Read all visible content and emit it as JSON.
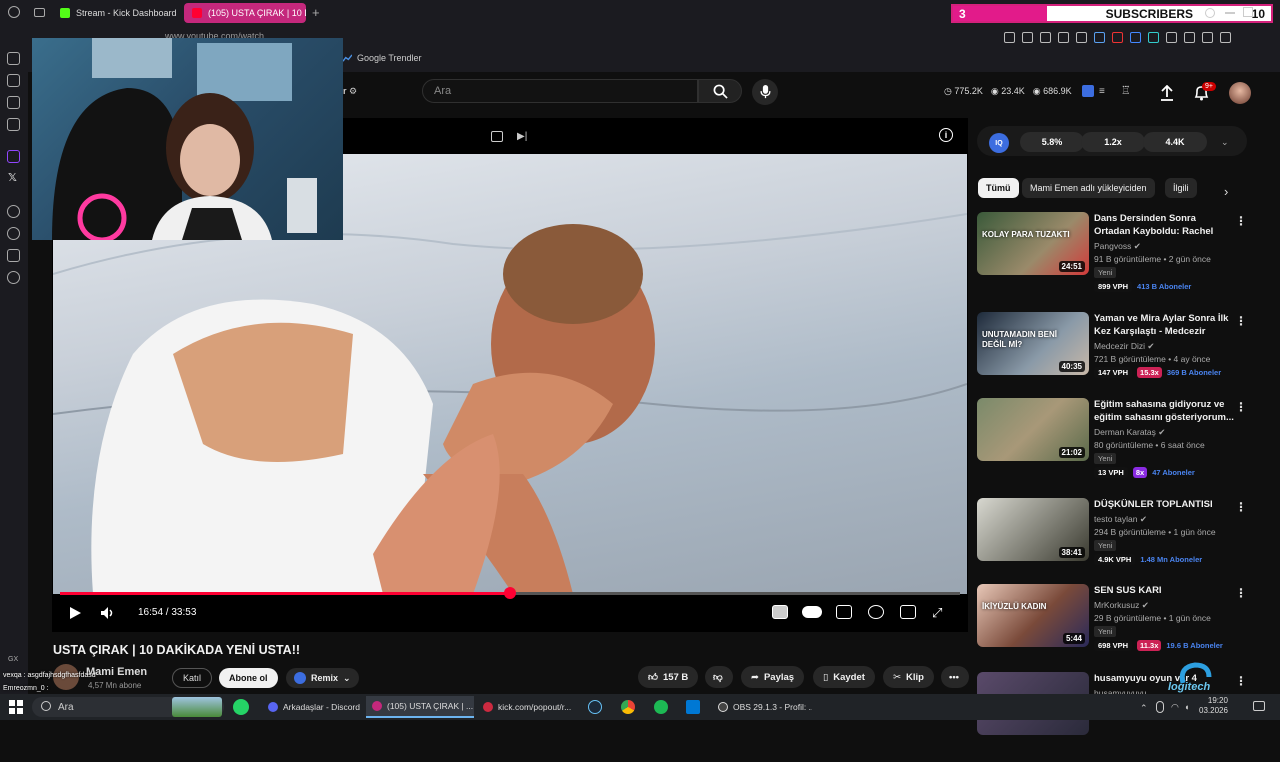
{
  "browser": {
    "tabs": [
      {
        "label": "Stream - Kick Dashboard",
        "color": "#53fc18"
      },
      {
        "label": "(105) USTA ÇIRAK | 10 DAK",
        "color": "#ff0033"
      }
    ],
    "new_tab_glyph": "+",
    "address": "www.youtube.com/watch",
    "bookmark": "Google Trendler"
  },
  "overlay": {
    "subscriber_count": "3",
    "subscriber_label": "SUBSCRIBERS",
    "subscriber_goal": "10",
    "chat_lines": [
      "vexqa : asgdfajhsdgfhasfdasd",
      "Emreozmn_0 :"
    ],
    "gx": "GX"
  },
  "youtube": {
    "search_placeholder": "Ara",
    "filter_glyph": "r",
    "stats": {
      "views": "775.2K",
      "likes": "23.4K",
      "other": "686.9K"
    },
    "notifications": "9+",
    "player": {
      "time": "16:54 / 33:53",
      "progress": 0.5
    },
    "video": {
      "title": "USTA ÇIRAK | 10 DAKİKADA YENİ USTA!!",
      "channel": "Mami Emen",
      "channel_subs": "4,57 Mn abone",
      "join": "Katıl",
      "subscribe": "Abone ol",
      "remix": "Remix",
      "likes": "157 B",
      "share": "Paylaş",
      "save": "Kaydet",
      "clip": "Klip"
    },
    "iq_bar": {
      "logo": "IQ",
      "pills": [
        "5.8%",
        "1.2x",
        "4.4K"
      ]
    },
    "chips": [
      "Tümü",
      "Mami Emen adlı yükleyiciden",
      "İlgili"
    ],
    "recommendations": [
      {
        "title": "Dans Dersinden Sonra Ortadan Kayboldu: Rachel Barber'a Ne ...",
        "channel": "Pangvoss",
        "meta": "91 B görüntüleme • 2 gün önce",
        "badge": "Yeni",
        "vph": "899 VPH",
        "mult": "",
        "subs": "413 B Aboneler",
        "duration": "24:51",
        "thumb_text": "KOLAY PARA TUZAKTI"
      },
      {
        "title": "Yaman ve Mira Aylar Sonra İlk Kez Karşılaştı - Medcezir",
        "channel": "Medcezir Dizi",
        "meta": "721 B görüntüleme • 4 ay önce",
        "badge": "",
        "vph": "147 VPH",
        "mult": "15.3x",
        "mult_color": "#cc2255",
        "subs": "369 B Aboneler",
        "duration": "40:35",
        "thumb_text": "UNUTAMADIN BENİ DEĞİL Mİ?"
      },
      {
        "title": "Eğitim sahasına gidiyoruz ve eğitim sahasını gösteriyorum...",
        "channel": "Derman Karataş",
        "meta": "80 görüntüleme • 6 saat önce",
        "badge": "Yeni",
        "vph": "13 VPH",
        "mult": "8x",
        "mult_color": "#8a2be2",
        "subs": "47 Aboneler",
        "duration": "21:02",
        "thumb_text": ""
      },
      {
        "title": "DÜŞKÜNLER TOPLANTISI",
        "channel": "testo taylan",
        "meta": "294 B görüntüleme • 1 gün önce",
        "badge": "Yeni",
        "vph": "4.9K VPH",
        "mult": "",
        "subs": "1.48 Mn Aboneler",
        "duration": "38:41",
        "thumb_text": ""
      },
      {
        "title": "SEN SUS KARI",
        "channel": "MrKorkusuz",
        "meta": "29 B görüntüleme • 1 gün önce",
        "badge": "Yeni",
        "vph": "698 VPH",
        "mult": "11.3x",
        "mult_color": "#cc2255",
        "subs": "19.6 B Aboneler",
        "duration": "5:44",
        "thumb_text": "İKİYÜZLÜ KADIN"
      },
      {
        "title": "husamyuyu oyun var 4",
        "channel": "husamyuyuyu",
        "meta": "",
        "badge": "",
        "vph": "",
        "mult": "",
        "subs": "",
        "duration": "",
        "thumb_text": ""
      }
    ]
  },
  "taskbar": {
    "search": "Ara",
    "items": [
      {
        "label": "Arkadaşlar - Discord",
        "color": "#5865f2"
      },
      {
        "label": "(105) USTA ÇIRAK | ...",
        "color": "#ff0033"
      },
      {
        "label": "kick.com/popout/r...",
        "color": "#cc2a40"
      },
      {
        "label": "OBS 29.1.3 - Profil: ...",
        "color": "#444"
      }
    ],
    "time": "19:20",
    "date": "03.2026",
    "brand": "logitech"
  }
}
